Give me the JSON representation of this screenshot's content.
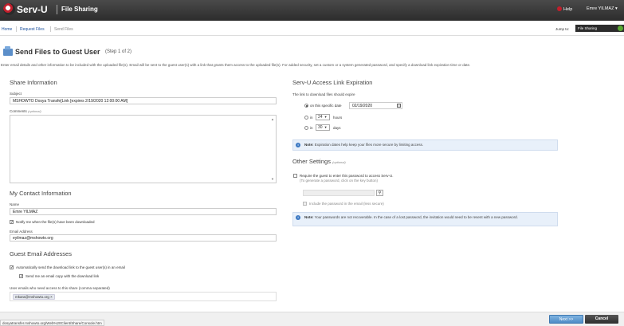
{
  "topbar": {
    "logo": "Serv-U",
    "app": "File Sharing",
    "help": "Help",
    "user": "Emre YILMAZ ▾"
  },
  "nav": {
    "home": "Home",
    "request": "Request Files",
    "send": "Send Files",
    "jump_label": "Jump to:",
    "jump_value": "File Sharing"
  },
  "page": {
    "title": "Send Files to Guest User",
    "step": "(Step 1 of 2)",
    "description": "Enter email details and other information to be included with the uploaded file(s). Email will be sent to the guest user(s) with a link that grants them access to the uploaded file(s). For added security, set a custom or a system generated password, and specify a download link expiration time or date."
  },
  "share": {
    "heading": "Share Information",
    "subject_label": "Subject",
    "subject_value": "MSHOWTO Dosya Transfe[Link [expires 2/19/2020 12:00:00 AM]",
    "comments_label": "Comments",
    "comments_optional": "(optional)"
  },
  "contact": {
    "heading": "My Contact Information",
    "name_label": "Name",
    "name_value": "Emre YILMAZ",
    "notify_label": "Notify me when the file(s) have been downloaded",
    "email_label": "Email Address",
    "email_value": "eyilmaz@mshowto.org"
  },
  "guest": {
    "heading": "Guest Email Addresses",
    "auto_send_label": "Automatically send the download link to the guest user(s) in an email",
    "copy_label": "Send me an email copy with the download link",
    "emails_label": "User emails who need access to this share (comma separated)",
    "tag": "mkara@mshowto.org ×"
  },
  "expiration": {
    "heading": "Serv-U Access Link Expiration",
    "intro": "The link to download files should expire",
    "on_date_label": "on this specific date",
    "date_value": "02/19/2020",
    "in_label": "in",
    "hours_value": "24",
    "hours_unit": "hours",
    "days_value": "30",
    "days_unit": "days",
    "note_bold": "Note:",
    "note_text": "Expiration dates help keep your files more secure by limiting access."
  },
  "other": {
    "heading": "Other Settings",
    "optional": "(optional)",
    "require_pw_label": "Require the guest to enter this password to access Serv-U.",
    "require_pw_hint": "(To generate a password, click on the key button)",
    "include_pw_label": "Include the password in the email (less secure)",
    "note_bold": "Note:",
    "note_text": "Your passwords are not recoverable. In the case of a lost password, the invitation would need to be resent with a new password."
  },
  "footer": {
    "next": "Next >>",
    "cancel": "Cancel",
    "status_url": "dosyatransfer.mshowto.org/Web%20Client/Share/Console.htm"
  }
}
